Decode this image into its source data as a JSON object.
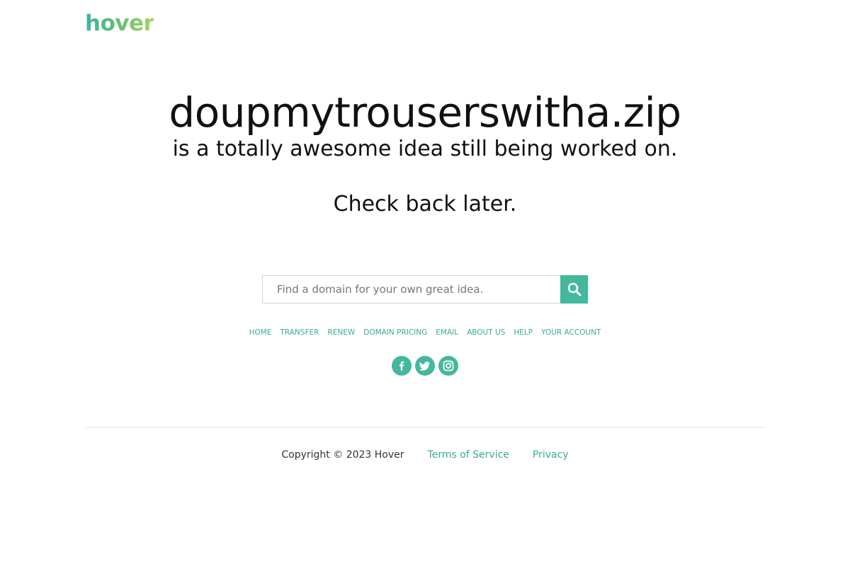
{
  "logo": {
    "text": "hover"
  },
  "hero": {
    "domain": "doupmytrouserswitha.zip",
    "tagline": "is a totally awesome idea still being worked on.",
    "check_back": "Check back later."
  },
  "search": {
    "placeholder": "Find a domain for your own great idea.",
    "button_icon": "search-icon"
  },
  "nav": {
    "items": [
      {
        "label": "HOME"
      },
      {
        "label": "TRANSFER"
      },
      {
        "label": "RENEW"
      },
      {
        "label": "DOMAIN PRICING"
      },
      {
        "label": "EMAIL"
      },
      {
        "label": "ABOUT US"
      },
      {
        "label": "HELP"
      },
      {
        "label": "YOUR ACCOUNT"
      }
    ]
  },
  "social": {
    "icons": [
      "facebook-icon",
      "twitter-icon",
      "instagram-icon"
    ]
  },
  "footer": {
    "copyright": "Copyright © 2023 Hover",
    "terms": "Terms of Service",
    "privacy": "Privacy"
  },
  "colors": {
    "accent": "#43b89c",
    "link": "#3aaa94",
    "text": "#111111"
  }
}
